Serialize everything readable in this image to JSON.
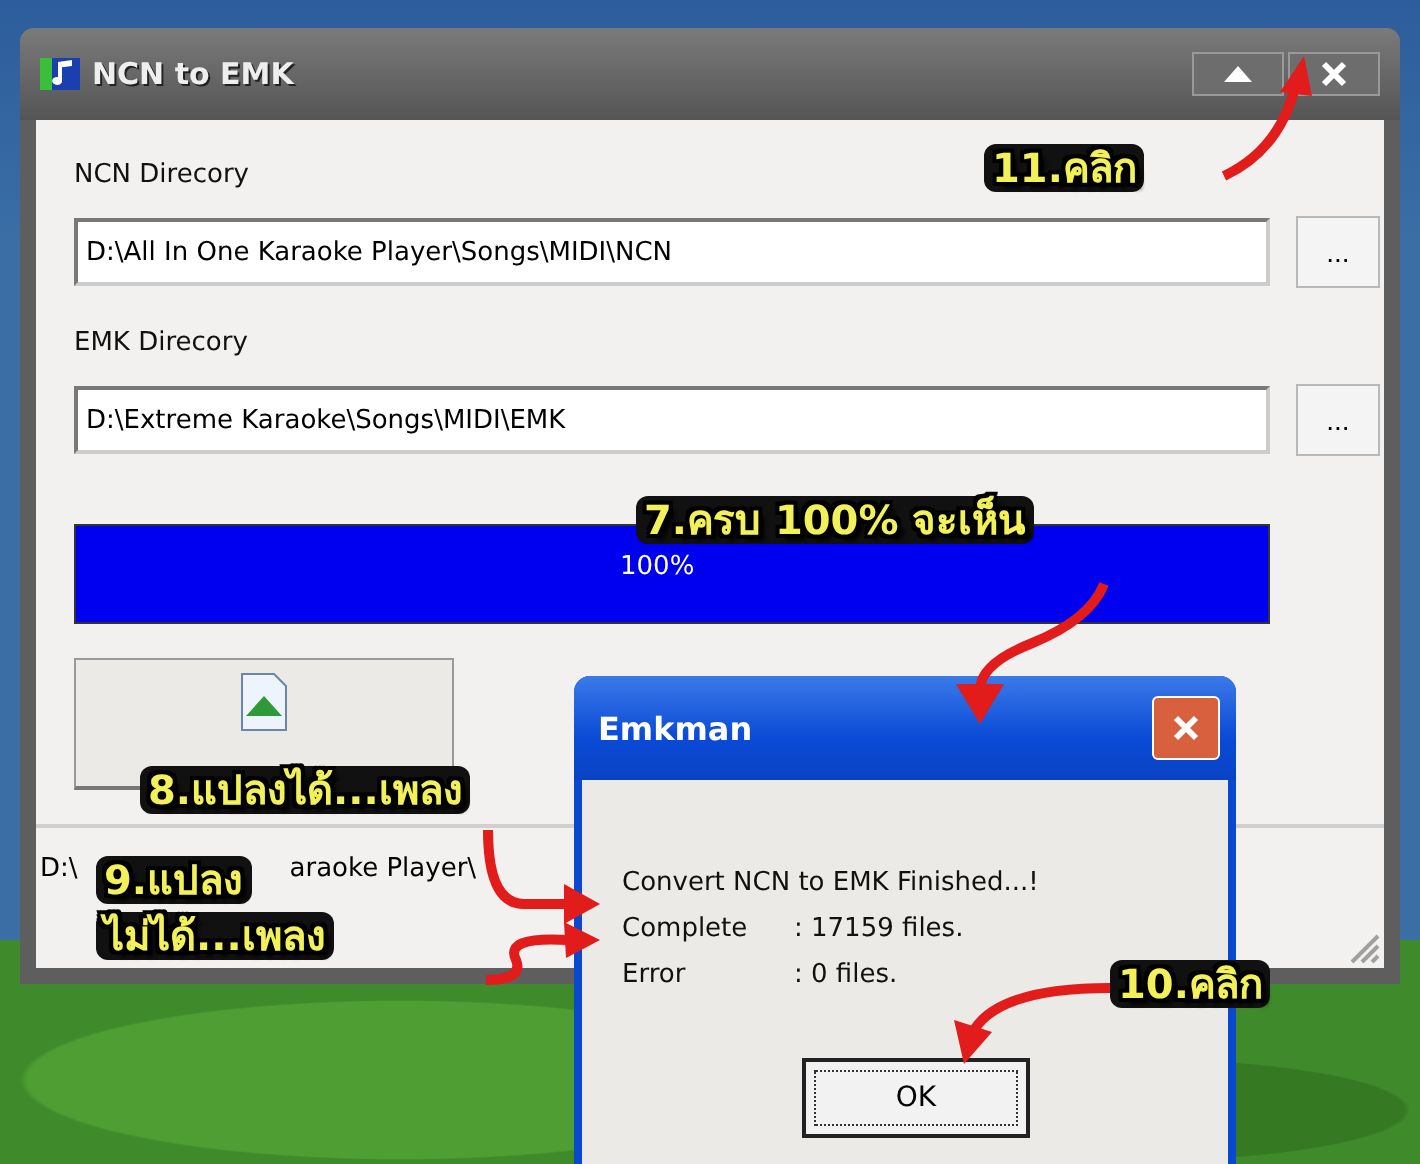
{
  "window": {
    "title": "NCN to EMK"
  },
  "fields": [
    {
      "label": "NCN Direcory",
      "value": "D:\\All In One Karaoke Player\\Songs\\MIDI\\NCN",
      "button": "..."
    },
    {
      "label": "EMK Direcory",
      "value": "D:\\Extreme Karaoke\\Songs\\MIDI\\EMK",
      "button": "..."
    }
  ],
  "progress": {
    "level": 1,
    "reading": "100%"
  },
  "status_bar": {
    "segments": [
      "D:\\",
      "araoke Player\\"
    ]
  },
  "dialog": {
    "title": "Emkman",
    "message": "Convert NCN to EMK Finished...!",
    "lines": [
      {
        "label": "Complete",
        "value": ": 17159 files."
      },
      {
        "label": "Error",
        "value": ": 0 files."
      }
    ],
    "ok": "OK"
  },
  "annotations": [
    {
      "lines": [
        "11.คลิก"
      ]
    },
    {
      "lines": [
        "7.ครบ 100% จะเห็น"
      ]
    },
    {
      "lines": [
        "8.แปลงได้...เพลง"
      ]
    },
    {
      "lines": [
        "9.แปลง",
        "ไม่ได้...เพลง"
      ]
    },
    {
      "lines": [
        "10.คลิก"
      ]
    }
  ]
}
